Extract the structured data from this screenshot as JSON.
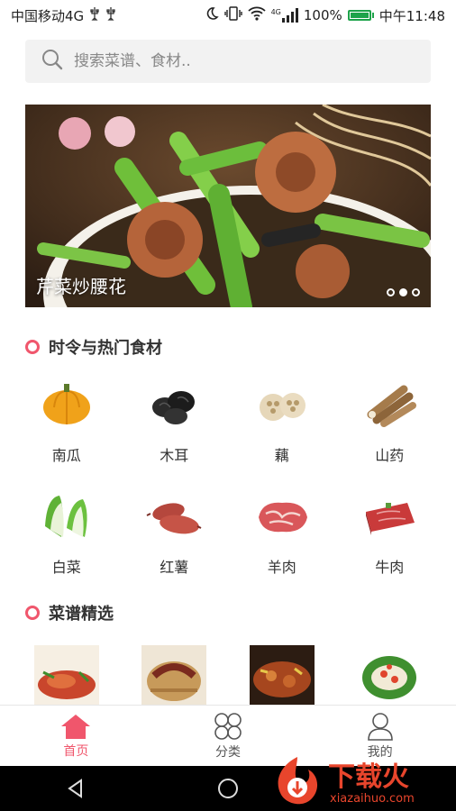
{
  "status_bar": {
    "carrier": "中国移动4G",
    "network": "4G",
    "battery": "100%",
    "battery_level": 1.0,
    "time": "中午11:48",
    "icons": [
      "usb-icon",
      "usb-icon",
      "moon-icon",
      "vibrate-icon",
      "wifi-icon",
      "signal-icon",
      "battery-icon"
    ]
  },
  "search": {
    "placeholder": "搜索菜谱、食材.."
  },
  "banner": {
    "caption": "芹菜炒腰花",
    "page_count": 3,
    "active_page": 2
  },
  "section_seasonal": {
    "title": "时令与热门食材",
    "items": [
      {
        "label": "南瓜",
        "icon": "pumpkin-icon"
      },
      {
        "label": "木耳",
        "icon": "wood-ear-icon"
      },
      {
        "label": "藕",
        "icon": "lotus-root-icon"
      },
      {
        "label": "山药",
        "icon": "yam-icon"
      },
      {
        "label": "白菜",
        "icon": "cabbage-icon"
      },
      {
        "label": "红薯",
        "icon": "sweet-potato-icon"
      },
      {
        "label": "羊肉",
        "icon": "mutton-icon"
      },
      {
        "label": "牛肉",
        "icon": "beef-icon"
      }
    ]
  },
  "section_recipes": {
    "title": "菜谱精选"
  },
  "tabbar": {
    "tabs": [
      {
        "label": "首页",
        "icon": "home-icon",
        "active": true
      },
      {
        "label": "分类",
        "icon": "category-icon",
        "active": false
      },
      {
        "label": "我的",
        "icon": "user-icon",
        "active": false
      }
    ]
  },
  "watermark": {
    "text": "下载火",
    "site": "xiazaihuo.com"
  },
  "colors": {
    "accent": "#f0566c",
    "battery": "#1ea34a",
    "search_bg": "#f2f2f2"
  }
}
